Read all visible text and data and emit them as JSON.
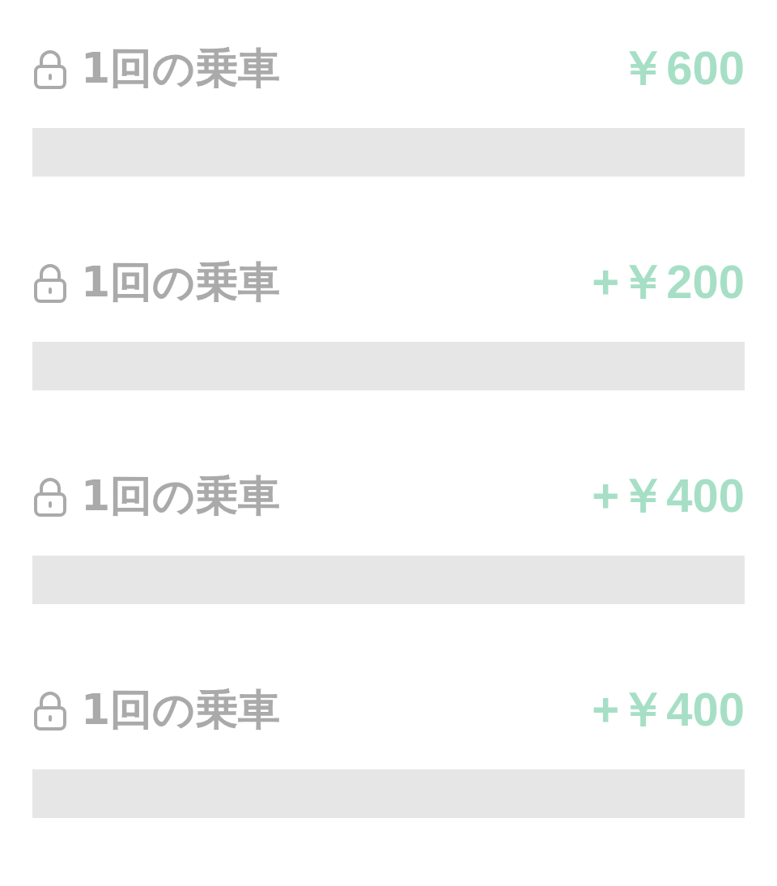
{
  "rides": [
    {
      "label": "1回の乗車",
      "price": "￥600",
      "locked": true
    },
    {
      "label": "1回の乗車",
      "price": "+￥200",
      "locked": true
    },
    {
      "label": "1回の乗車",
      "price": "+￥400",
      "locked": true
    },
    {
      "label": "1回の乗車",
      "price": "+￥400",
      "locked": true
    }
  ]
}
